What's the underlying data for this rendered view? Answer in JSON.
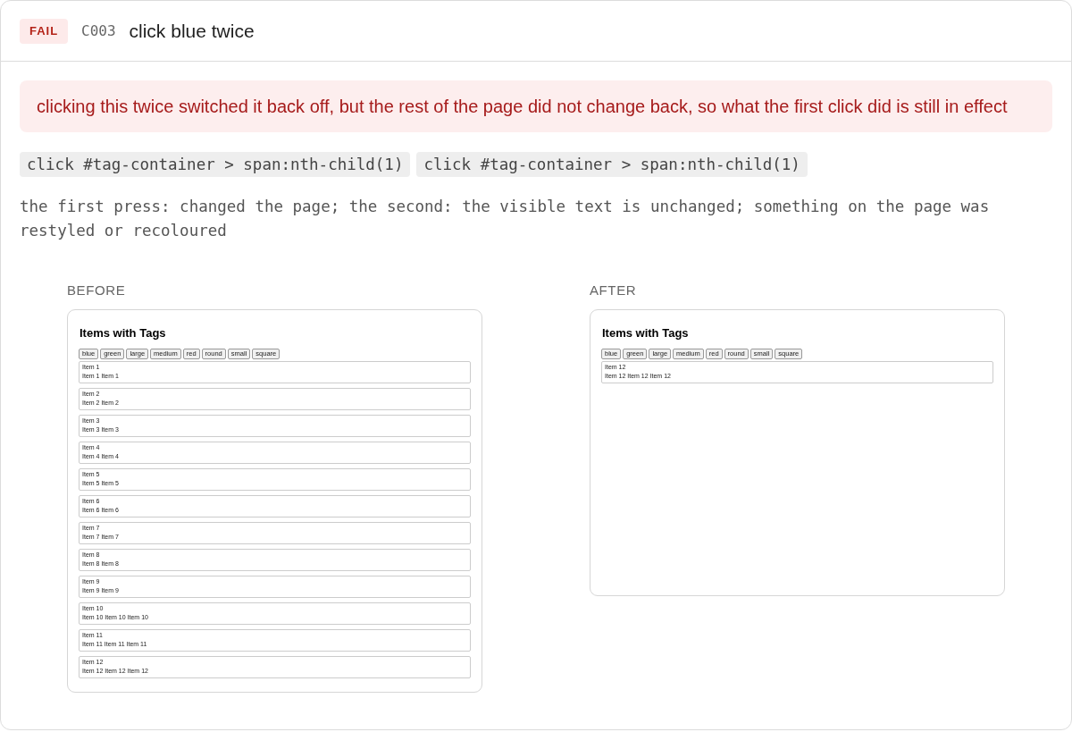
{
  "header": {
    "status": {
      "text": "FAIL",
      "kind": "fail"
    },
    "case_id": "C003",
    "title": "click blue twice"
  },
  "alert": {
    "kind": "error",
    "message": "clicking this twice switched it back off, but the rest of the page did not change back, so what the first click did is still in effect"
  },
  "steps": [
    "click #tag-container > span:nth-child(1)",
    "click #tag-container > span:nth-child(1)"
  ],
  "note": "the first press: changed the page; the second: the visible text is unchanged; something on the page was restyled or recoloured",
  "screenshots": [
    {
      "label": "BEFORE",
      "page": {
        "heading": "Items with Tags",
        "tags": [
          "blue",
          "green",
          "large",
          "medium",
          "red",
          "round",
          "small",
          "square"
        ],
        "items": [
          {
            "title": "Item 1",
            "text": "Item 1 Item 1"
          },
          {
            "title": "Item 2",
            "text": "Item 2 Item 2"
          },
          {
            "title": "Item 3",
            "text": "Item 3 Item 3"
          },
          {
            "title": "Item 4",
            "text": "Item 4 Item 4"
          },
          {
            "title": "Item 5",
            "text": "Item 5 Item 5"
          },
          {
            "title": "Item 6",
            "text": "Item 6 Item 6"
          },
          {
            "title": "Item 7",
            "text": "Item 7 Item 7"
          },
          {
            "title": "Item 8",
            "text": "Item 8 Item 8"
          },
          {
            "title": "Item 9",
            "text": "Item 9 Item 9"
          },
          {
            "title": "Item 10",
            "text": "Item 10 Item 10 Item 10"
          },
          {
            "title": "Item 11",
            "text": "Item 11 Item 11 Item 11"
          },
          {
            "title": "Item 12",
            "text": "Item 12 Item 12 Item 12"
          }
        ]
      }
    },
    {
      "label": "AFTER",
      "page": {
        "heading": "Items with Tags",
        "tags": [
          "blue",
          "green",
          "large",
          "medium",
          "red",
          "round",
          "small",
          "square"
        ],
        "items": [
          {
            "title": "Item 12",
            "text": "Item 12 Item 12 Item 12"
          }
        ]
      }
    }
  ]
}
